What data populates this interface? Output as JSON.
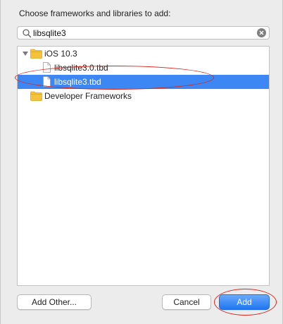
{
  "dialog": {
    "prompt": "Choose frameworks and libraries to add:"
  },
  "search": {
    "value": "libsqlite3",
    "icon": "magnifier",
    "clear_icon": "x-circle"
  },
  "tree": {
    "group_ios": {
      "label": "iOS 10.3",
      "expanded": true
    },
    "item_sqlite30": {
      "label": "libsqlite3.0.tbd"
    },
    "item_sqlite3": {
      "label": "libsqlite3.tbd",
      "selected": true
    },
    "group_dev": {
      "label": "Developer Frameworks",
      "expanded": false
    }
  },
  "buttons": {
    "add_other": "Add Other...",
    "cancel": "Cancel",
    "add": "Add"
  },
  "colors": {
    "selection": "#3d87f5",
    "callout": "#d9261c",
    "folder": "#f5c33b"
  }
}
